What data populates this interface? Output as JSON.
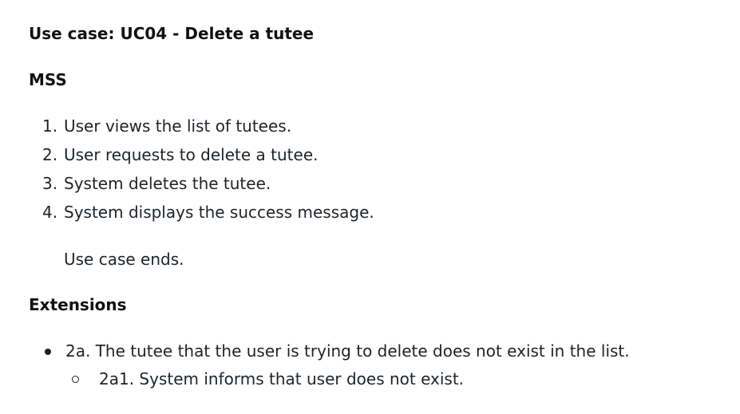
{
  "document": {
    "title": "Use case: UC04 - Delete a tutee",
    "mss_heading": "MSS",
    "mss_steps": [
      {
        "number": "1.",
        "text": "User views the list of tutees."
      },
      {
        "number": "2.",
        "text": "User requests to delete a tutee."
      },
      {
        "number": "3.",
        "text": "System deletes the tutee."
      },
      {
        "number": "4.",
        "text": "System displays the success message."
      }
    ],
    "mss_end": "Use case ends.",
    "extensions_heading": "Extensions",
    "extensions": [
      {
        "text": "2a. The tutee that the user is trying to delete does not exist in the list.",
        "sub": [
          "2a1. System informs that user does not exist."
        ]
      }
    ]
  }
}
